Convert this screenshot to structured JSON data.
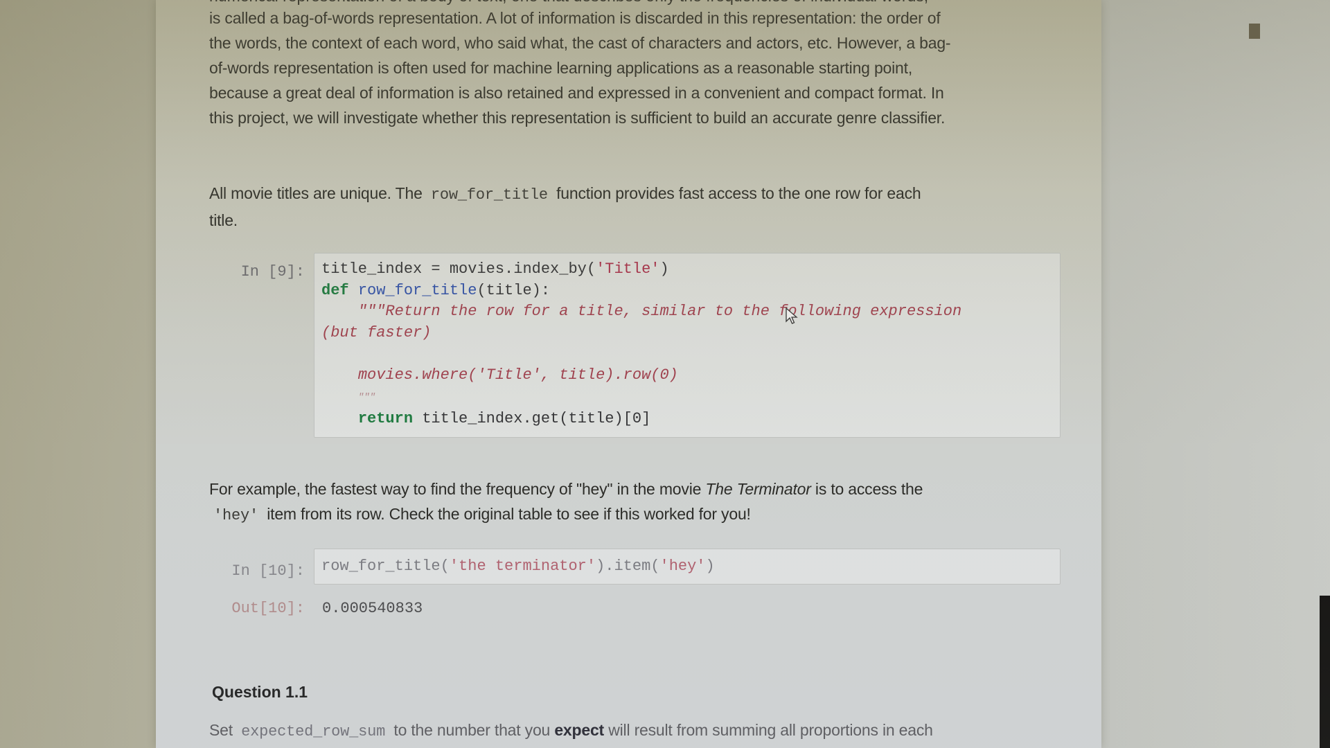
{
  "notebook": {
    "clipped_top_line": "numerical representation of a body of text, one that describes only the frequencies of individual words,",
    "intro_paragraph": [
      "is called a bag-of-words representation. A lot of information is discarded in this representation: the order of",
      "the words, the context of each word, who said what, the cast of characters and actors, etc. However, a bag-",
      "of-words representation is often used for machine learning applications as a reasonable starting point,",
      "because a great deal of information is also retained and expressed in a convenient and compact format. In",
      "this project, we will investigate whether this representation is sufficient to build an accurate genre classifier."
    ],
    "unique_titles_paragraph": {
      "before": "All movie titles are unique. The",
      "code": "row_for_title",
      "after": "function provides fast access to the one row for each",
      "line2": "title."
    },
    "cell9": {
      "prompt": "In [9]:",
      "lines": {
        "l1_var": "title_index = movies.index_by(",
        "l1_str": "'Title'",
        "l1_end": ")",
        "l2_kw": "def",
        "l2_fn": "row_for_title",
        "l2_rest": "(title):",
        "l3_doc": "\"\"\"Return the row for a title, similar to the following expression",
        "l4_doc": "(but faster)",
        "l6_doc": "movies.where('Title', title).row(0)",
        "l7_doc": "\"\"\"",
        "l8_kw": "return",
        "l8_rest": "title_index.get(title)[0]"
      }
    },
    "example_paragraph": {
      "before": "For example, the fastest way to find the frequency of \"hey\" in the movie",
      "movie": "The Terminator",
      "after": "is to access the",
      "code": "'hey'",
      "line2": "item from its row. Check the original table to see if this worked for you!"
    },
    "cell10": {
      "prompt": "In [10]:",
      "code_pre": "row_for_title(",
      "code_str1": "'the terminator'",
      "code_mid": ").item(",
      "code_str2": "'hey'",
      "code_end": ")",
      "out_prompt": "Out[10]:",
      "output": "0.000540833"
    },
    "question": {
      "title": "Question 1.1",
      "set": "Set",
      "code": "expected_row_sum",
      "text1": "to the number that you",
      "bold": "expect",
      "text2": "will result from summing all proportions in each"
    }
  }
}
